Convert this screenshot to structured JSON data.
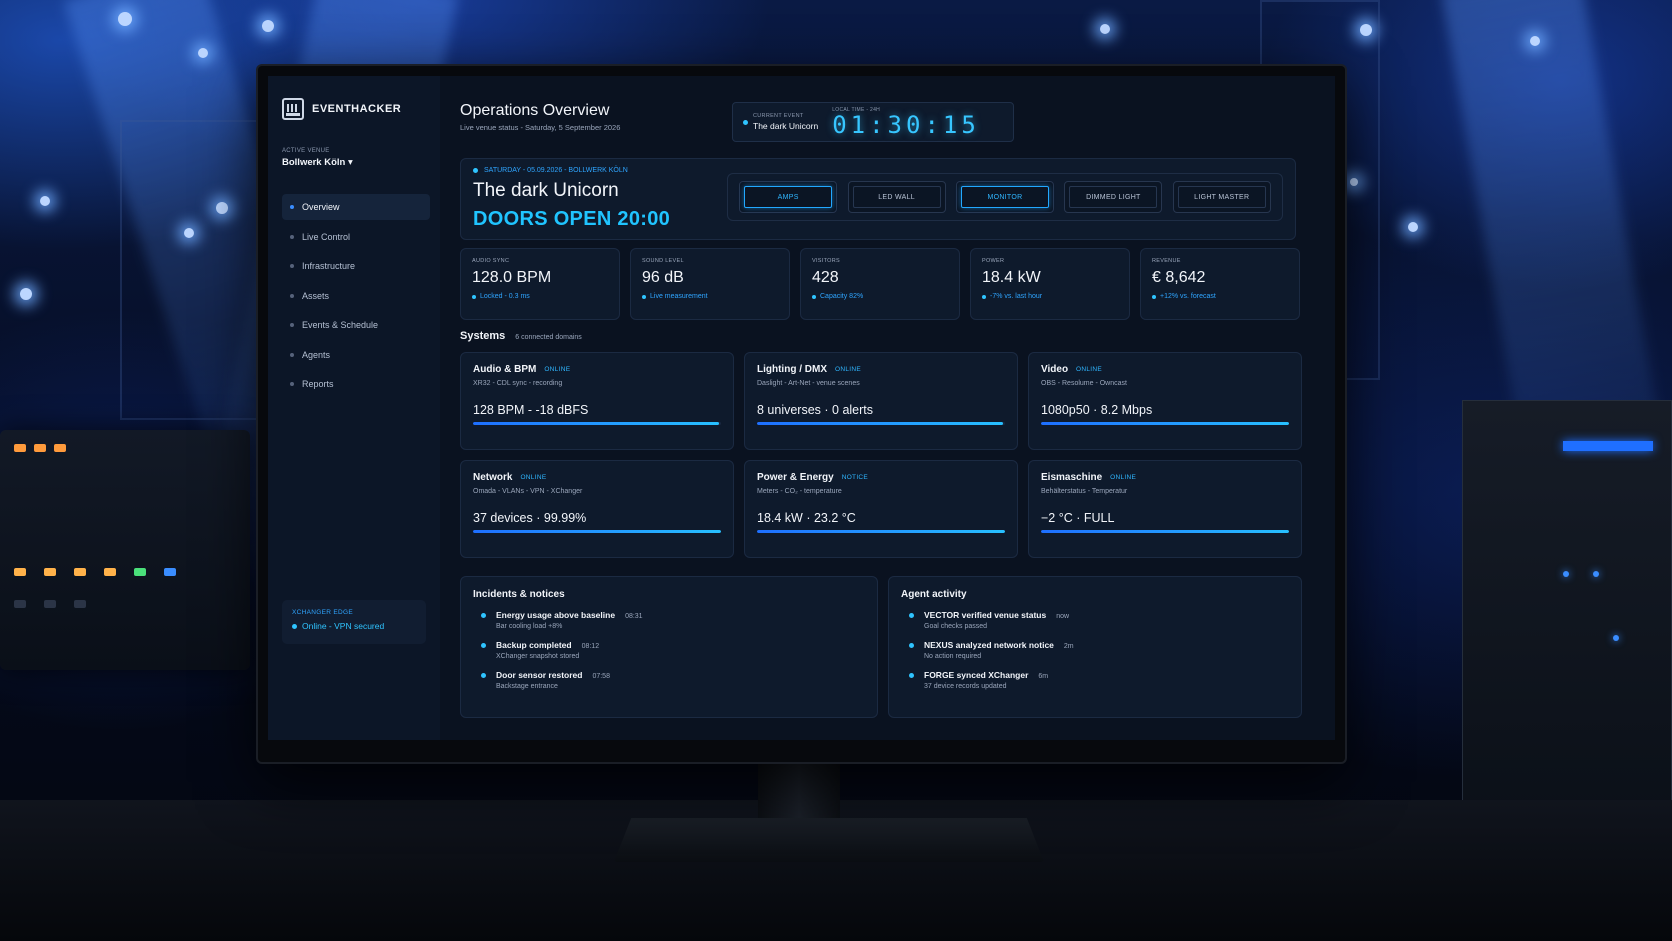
{
  "brand": {
    "name": "EVENTHACKER"
  },
  "venue": {
    "label": "ACTIVE VENUE",
    "value": "Bollwerk Köln ▾"
  },
  "nav": [
    {
      "label": "Overview",
      "active": true
    },
    {
      "label": "Live Control"
    },
    {
      "label": "Infrastructure"
    },
    {
      "label": "Assets"
    },
    {
      "label": "Events & Schedule"
    },
    {
      "label": "Agents"
    },
    {
      "label": "Reports"
    }
  ],
  "edge": {
    "label": "XCHANGER EDGE",
    "status": "Online - VPN secured"
  },
  "header": {
    "title": "Operations Overview",
    "subtitle": "Live venue status - Saturday, 5 September 2026",
    "current_event_label": "CURRENT EVENT",
    "current_event": "The dark Unicorn",
    "clock_label": "LOCAL TIME - 24H",
    "clock": "01:30:15"
  },
  "hero": {
    "date_line": "SATURDAY - 05.09.2026 - BOLLWERK KÖLN",
    "title": "The dark Unicorn",
    "doors": "DOORS OPEN 20:00",
    "controls": [
      {
        "label": "AMPS",
        "on": true
      },
      {
        "label": "LED WALL",
        "on": false
      },
      {
        "label": "MONITOR",
        "on": true
      },
      {
        "label": "DIMMED LIGHT",
        "on": false
      },
      {
        "label": "LIGHT MASTER",
        "on": false
      }
    ]
  },
  "kpis": [
    {
      "label": "AUDIO SYNC",
      "value": "128.0 BPM",
      "note": "Locked - 0.3 ms"
    },
    {
      "label": "SOUND LEVEL",
      "value": "96 dB",
      "note": "Live measurement"
    },
    {
      "label": "VISITORS",
      "value": "428",
      "note": "Capacity 82%"
    },
    {
      "label": "POWER",
      "value": "18.4 kW",
      "note": "-7% vs. last hour"
    },
    {
      "label": "REVENUE",
      "value": "€ 8,642",
      "note": "+12% vs. forecast"
    }
  ],
  "systems": {
    "title": "Systems",
    "count": "6 connected domains",
    "cards": [
      {
        "name": "Audio & BPM",
        "status": "ONLINE",
        "desc": "XR32 - CDL sync - recording",
        "metric": "128 BPM - -18 dBFS",
        "level": 0.99
      },
      {
        "name": "Lighting / DMX",
        "status": "ONLINE",
        "desc": "Daslight - Art-Net - venue scenes",
        "metric": "8 universes · 0 alerts",
        "level": 0.99
      },
      {
        "name": "Video",
        "status": "ONLINE",
        "desc": "OBS - Resolume - Owncast",
        "metric": "1080p50 · 8.2 Mbps",
        "level": 1.0
      },
      {
        "name": "Network",
        "status": "ONLINE",
        "desc": "Omada - VLANs - VPN - XChanger",
        "metric": "37 devices · 99.99%",
        "level": 1.0
      },
      {
        "name": "Power & Energy",
        "status": "NOTICE",
        "desc": "Meters - CO₂ - temperature",
        "metric": "18.4 kW · 23.2 °C",
        "level": 1.0
      },
      {
        "name": "Eismaschine",
        "status": "ONLINE",
        "desc": "Behälterstatus - Temperatur",
        "metric": "−2 °C · FULL",
        "level": 1.0
      }
    ]
  },
  "incidents": {
    "title": "Incidents & notices",
    "items": [
      {
        "title": "Energy usage above baseline",
        "time": "08:31",
        "sub": "Bar cooling load +8%"
      },
      {
        "title": "Backup completed",
        "time": "08:12",
        "sub": "XChanger snapshot stored"
      },
      {
        "title": "Door sensor restored",
        "time": "07:58",
        "sub": "Backstage entrance"
      }
    ]
  },
  "agents": {
    "title": "Agent activity",
    "items": [
      {
        "title": "VECTOR verified venue status",
        "time": "now",
        "sub": "Goal checks passed"
      },
      {
        "title": "NEXUS analyzed network notice",
        "time": "2m",
        "sub": "No action required"
      },
      {
        "title": "FORGE synced XChanger",
        "time": "6m",
        "sub": "37 device records updated"
      }
    ]
  }
}
